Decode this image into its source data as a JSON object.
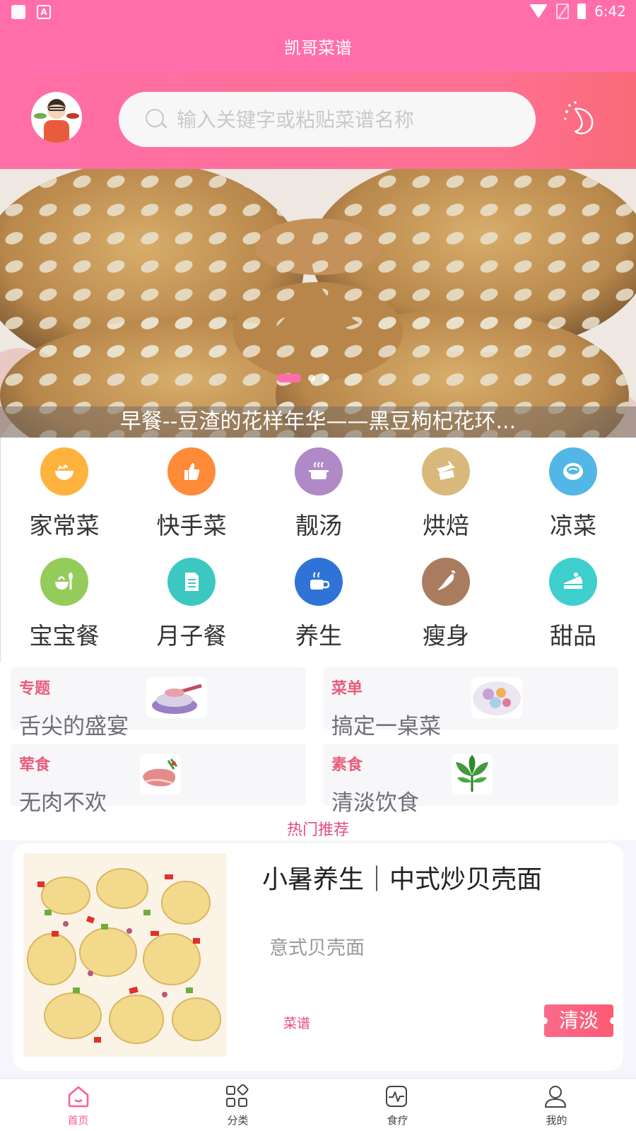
{
  "status_bar": {
    "time": "6:42"
  },
  "app_bar": {
    "title": "凯哥菜谱"
  },
  "search": {
    "placeholder": "输入关键字或粘贴菜谱名称"
  },
  "icons": {
    "avatar": "chef-avatar-icon",
    "search": "search-icon",
    "theme": "moon-icon"
  },
  "banner": {
    "caption": "早餐--豆渣的花样年华——黑豆枸杞花环...",
    "slide_count": 3,
    "active_slide": 1
  },
  "categories": [
    {
      "label": "家常菜",
      "icon": "rice-bowl-icon",
      "color": "#ffb33f"
    },
    {
      "label": "快手菜",
      "icon": "thumbs-up-icon",
      "color": "#ff8a38"
    },
    {
      "label": "靓汤",
      "icon": "soup-pot-icon",
      "color": "#b08ac7"
    },
    {
      "label": "烘焙",
      "icon": "baking-icon",
      "color": "#d9b97b"
    },
    {
      "label": "凉菜",
      "icon": "cold-dish-icon",
      "color": "#52b7e6"
    },
    {
      "label": "宝宝餐",
      "icon": "baby-food-icon",
      "color": "#94cc5b"
    },
    {
      "label": "月子餐",
      "icon": "document-icon",
      "color": "#3cc8c1"
    },
    {
      "label": "养生",
      "icon": "hot-drink-icon",
      "color": "#2f73d6"
    },
    {
      "label": "瘦身",
      "icon": "chili-icon",
      "color": "#a97c60"
    },
    {
      "label": "甜品",
      "icon": "cake-icon",
      "color": "#3fcfcd"
    }
  ],
  "topics": [
    {
      "tag": "专题",
      "title": "舌尖的盛宴"
    },
    {
      "tag": "菜单",
      "title": "搞定一桌菜"
    },
    {
      "tag": "荤食",
      "title": "无肉不欢"
    },
    {
      "tag": "素食",
      "title": "清淡饮食"
    }
  ],
  "hot": {
    "title": "热门推荐"
  },
  "recommend": {
    "title": "小暑养生｜中式炒贝壳面",
    "subtitle": "意式贝壳面",
    "type": "菜谱",
    "tag": "清淡"
  },
  "bottom_nav": [
    {
      "label": "首页",
      "icon": "home-icon",
      "active": true
    },
    {
      "label": "分类",
      "icon": "grid-icon",
      "active": false
    },
    {
      "label": "食疗",
      "icon": "heartbeat-icon",
      "active": false
    },
    {
      "label": "我的",
      "icon": "user-icon",
      "active": false
    }
  ],
  "colors": {
    "primary": "#ff6eaa",
    "accent_text": "#e84a86",
    "tag_red": "#ea5d7b"
  }
}
